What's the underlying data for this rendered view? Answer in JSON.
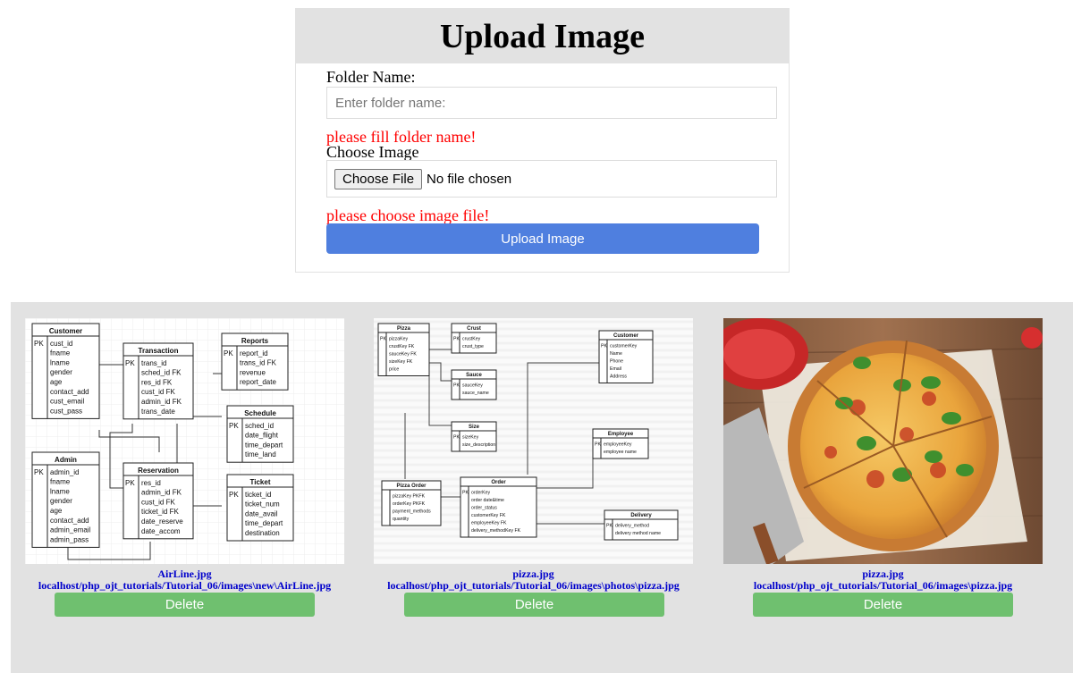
{
  "upload": {
    "title": "Upload Image",
    "folder_label": "Folder Name:",
    "folder_placeholder": "Enter folder name:",
    "folder_error": "please fill folder name!",
    "image_label": "Choose Image",
    "file_button": "Choose File",
    "file_status": "No file chosen",
    "image_error": "please choose image file!",
    "submit_label": "Upload Image"
  },
  "gallery": {
    "items": [
      {
        "name": "AirLine.jpg",
        "path": "localhost/php_ojt_tutorials/Tutorial_06/images\\new\\AirLine.jpg",
        "delete_label": "Delete"
      },
      {
        "name": "pizza.jpg",
        "path": "localhost/php_ojt_tutorials/Tutorial_06/images\\photos\\pizza.jpg",
        "delete_label": "Delete"
      },
      {
        "name": "pizza.jpg",
        "path": "localhost/php_ojt_tutorials/Tutorial_06/images\\pizza.jpg",
        "delete_label": "Delete"
      }
    ]
  },
  "colors": {
    "upload_button": "#4f7fdf",
    "delete_button": "#6fc06f",
    "error_text": "#ff0000",
    "link_text": "#0000cc",
    "panel_background": "#e2e2e2"
  },
  "erd_airline": {
    "entities": [
      {
        "title": "Customer",
        "pk": "PK",
        "fields": [
          "cust_id",
          "fname",
          "lname",
          "gender",
          "age",
          "contact_add",
          "cust_email",
          "cust_pass"
        ]
      },
      {
        "title": "Transaction",
        "pk": "PK",
        "fields": [
          "trans_id",
          "sched_id FK",
          "res_id FK",
          "cust_id FK",
          "admin_id FK",
          "trans_date"
        ]
      },
      {
        "title": "Reports",
        "pk": "PK",
        "fields": [
          "report_id",
          "trans_id FK",
          "revenue",
          "report_date"
        ]
      },
      {
        "title": "Schedule",
        "pk": "PK",
        "fields": [
          "sched_id",
          "date_flight",
          "time_depart",
          "time_land"
        ]
      },
      {
        "title": "Admin",
        "pk": "PK",
        "fields": [
          "admin_id",
          "fname",
          "lname",
          "gender",
          "age",
          "contact_add",
          "admin_email",
          "admin_pass"
        ]
      },
      {
        "title": "Reservation",
        "pk": "PK",
        "fields": [
          "res_id",
          "admin_id FK",
          "cust_id FK",
          "ticket_id FK",
          "date_reserve",
          "date_accom"
        ]
      },
      {
        "title": "Ticket",
        "pk": "PK",
        "fields": [
          "ticket_id",
          "ticket_num",
          "date_avail",
          "time_depart",
          "destination"
        ]
      }
    ]
  },
  "erd_pizza": {
    "entities": [
      {
        "title": "Pizza",
        "pk": "PK",
        "fields": [
          "pizzaKey",
          "crustKey FK",
          "sauceKey FK",
          "sizeKey FK",
          "price"
        ]
      },
      {
        "title": "Crust",
        "pk": "PK",
        "fields": [
          "crustKey",
          "crust_type"
        ]
      },
      {
        "title": "Sauce",
        "pk": "PK",
        "fields": [
          "sauceKey",
          "sauce_name"
        ]
      },
      {
        "title": "Size",
        "pk": "PK",
        "fields": [
          "sizeKey",
          "size_description"
        ]
      },
      {
        "title": "Customer",
        "pk": "PK",
        "fields": [
          "customerKey",
          "Name",
          "Phone",
          "Email",
          "Address"
        ]
      },
      {
        "title": "Employee",
        "pk": "PK",
        "fields": [
          "employeeKey",
          "employee name"
        ]
      },
      {
        "title": "Pizza Order",
        "pk": "",
        "fields": [
          "pizzaKey PKFK",
          "orderKey PKFK",
          "payment_methods",
          "quantity"
        ]
      },
      {
        "title": "Order",
        "pk": "PK",
        "fields": [
          "orderKey",
          "order date&time",
          "order_status",
          "customerKey FK",
          "employeeKey FK",
          "delivery_methodKey FK"
        ]
      },
      {
        "title": "Delivery",
        "pk": "PK",
        "fields": [
          "delivery_method",
          "delivery method name"
        ]
      }
    ]
  }
}
